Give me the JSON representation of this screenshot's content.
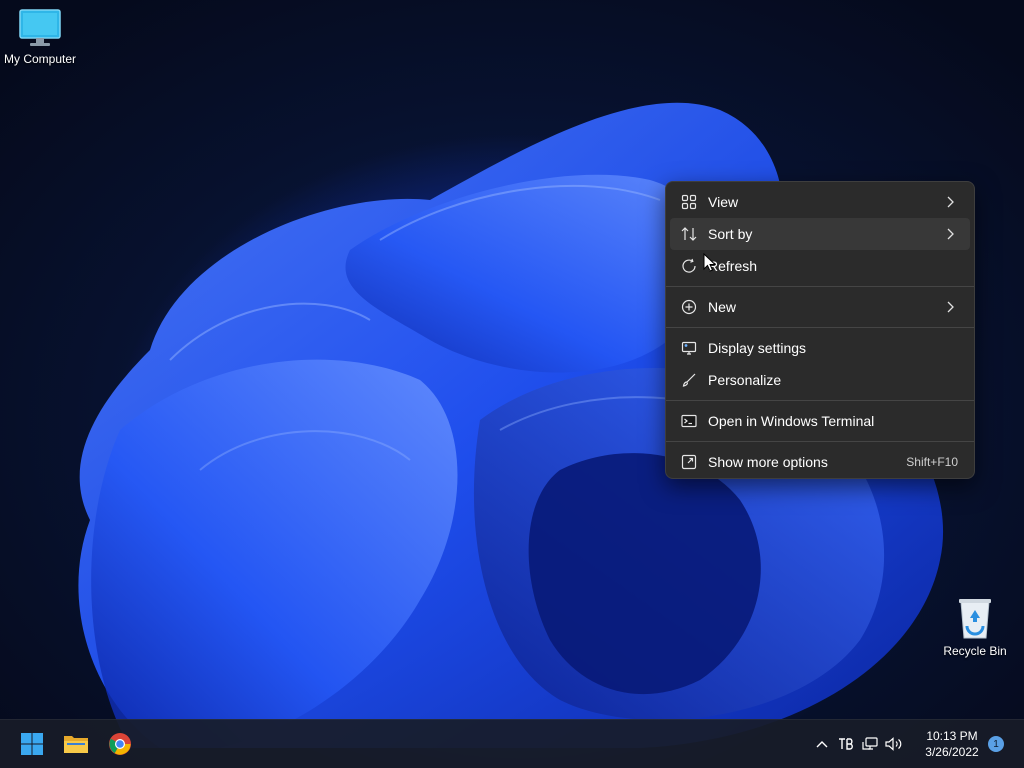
{
  "desktop": {
    "icons": [
      {
        "label": "My Computer",
        "icon": "monitor-icon"
      },
      {
        "label": "Recycle Bin",
        "icon": "recycle-bin-icon"
      }
    ]
  },
  "context_menu": {
    "items": [
      {
        "label": "View",
        "icon": "grid-view-icon",
        "has_submenu": true
      },
      {
        "label": "Sort by",
        "icon": "sort-icon",
        "has_submenu": true,
        "hovered": true
      },
      {
        "label": "Refresh",
        "icon": "refresh-icon"
      },
      {
        "label": "New",
        "icon": "plus-circle-icon",
        "has_submenu": true
      },
      {
        "label": "Display settings",
        "icon": "display-settings-icon"
      },
      {
        "label": "Personalize",
        "icon": "brush-icon"
      },
      {
        "label": "Open in Windows Terminal",
        "icon": "terminal-icon"
      },
      {
        "label": "Show more options",
        "icon": "more-options-icon",
        "shortcut": "Shift+F10"
      }
    ]
  },
  "taskbar": {
    "pinned": [
      {
        "name": "Start",
        "icon": "windows-start-icon"
      },
      {
        "name": "File Explorer",
        "icon": "folder-icon"
      },
      {
        "name": "Google Chrome",
        "icon": "chrome-icon"
      }
    ],
    "tray_icons": [
      "chevron-up-icon",
      "input-indicator-icon",
      "network-icon",
      "volume-icon"
    ],
    "clock": {
      "time": "10:13 PM",
      "date": "3/26/2022"
    },
    "notification_count": "1"
  },
  "colors": {
    "menu_bg": "#2b2b2b",
    "menu_hover": "#383838",
    "accent": "#1438c8",
    "taskbar_bg": "#181c28"
  }
}
